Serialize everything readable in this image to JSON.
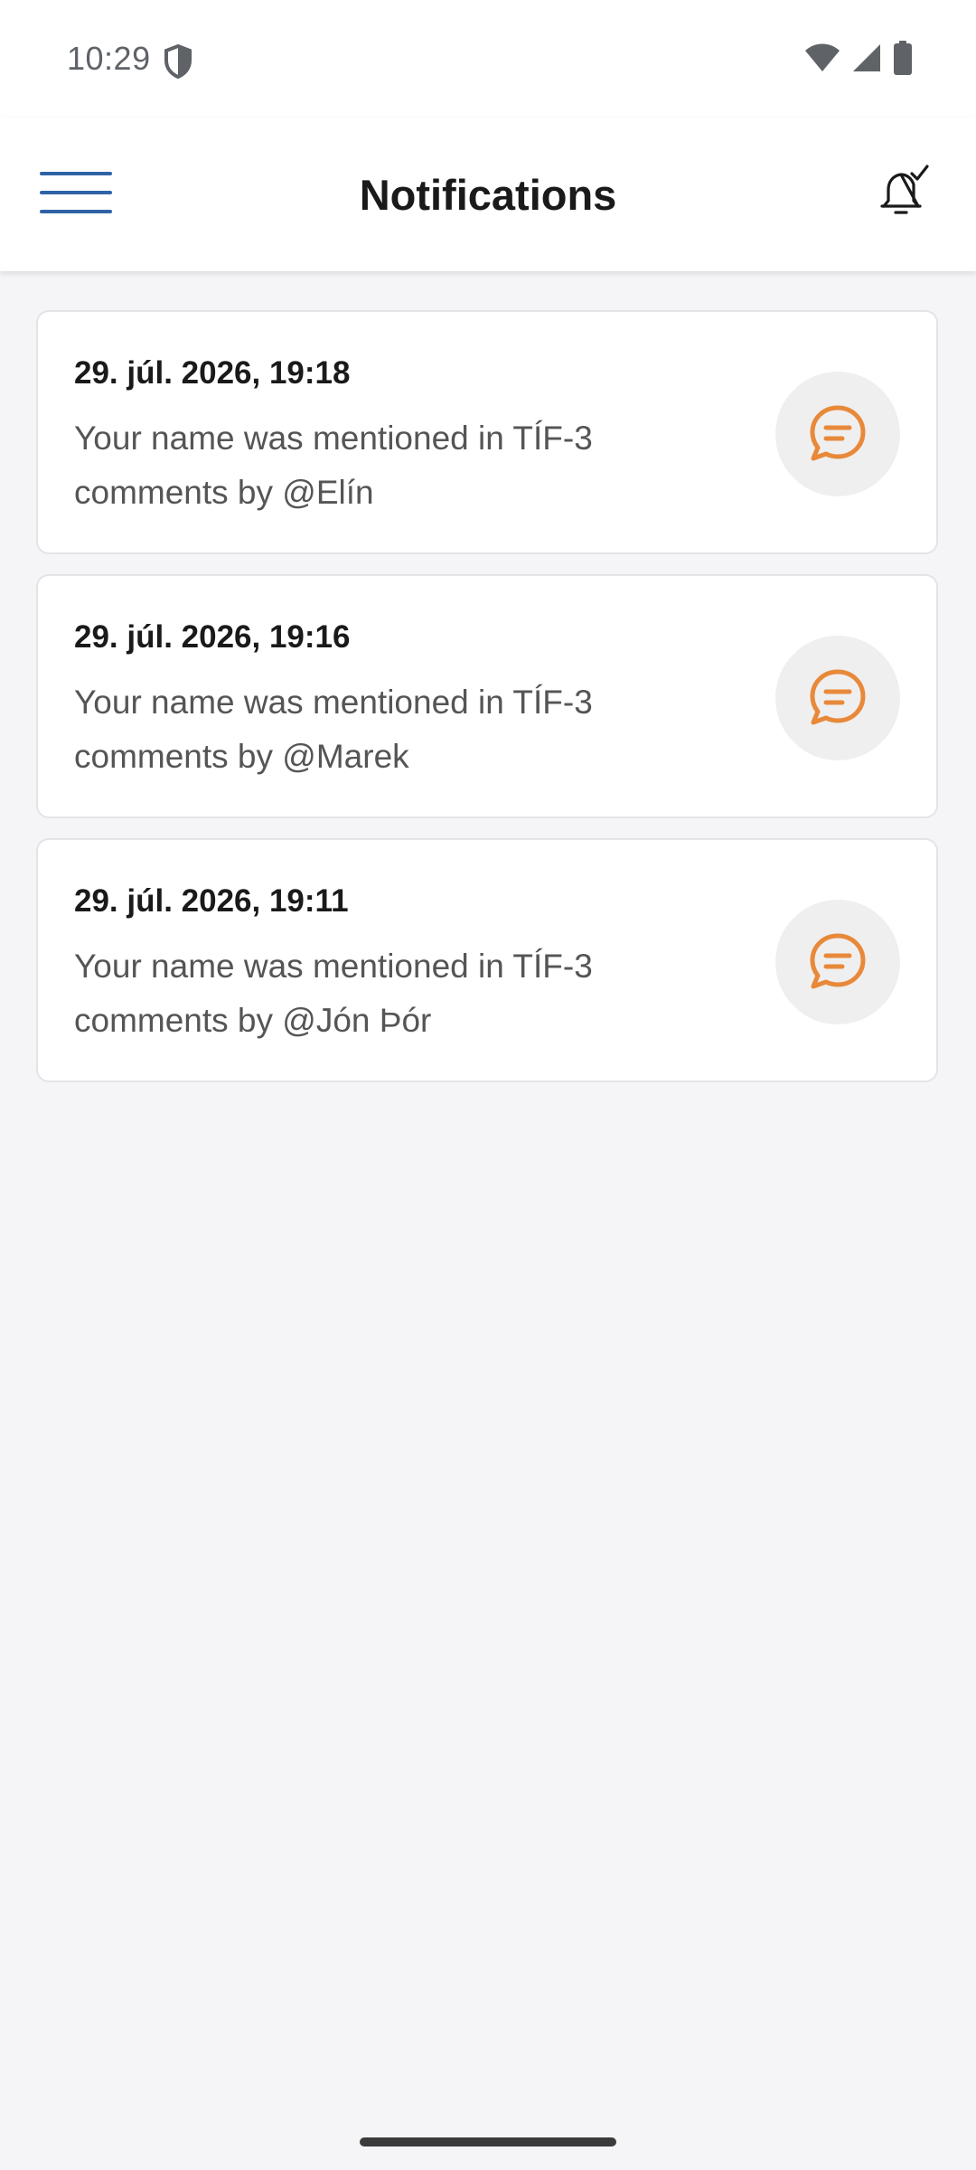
{
  "status_bar": {
    "time": "10:29"
  },
  "header": {
    "title": "Notifications"
  },
  "notifications": [
    {
      "date": "29. júl. 2026, 19:18",
      "text": "Your name was mentioned in TÍF-3 comments by @Elín",
      "icon": "comment-icon"
    },
    {
      "date": "29. júl. 2026, 19:16",
      "text": "Your name was mentioned in TÍF-3 comments by @Marek",
      "icon": "comment-icon"
    },
    {
      "date": "29. júl. 2026, 19:11",
      "text": "Your name was mentioned in TÍF-3 comments by @Jón Þór",
      "icon": "comment-icon"
    }
  ],
  "icons": {
    "menu": "hamburger-menu-icon",
    "mark_read": "bell-check-icon",
    "status": [
      "shield-icon",
      "wifi-icon",
      "cellular-signal-icon",
      "battery-icon"
    ]
  },
  "colors": {
    "accent": "#2f63a6",
    "comment_icon": "#e8893a",
    "background": "#f5f5f7",
    "card": "#ffffff"
  }
}
